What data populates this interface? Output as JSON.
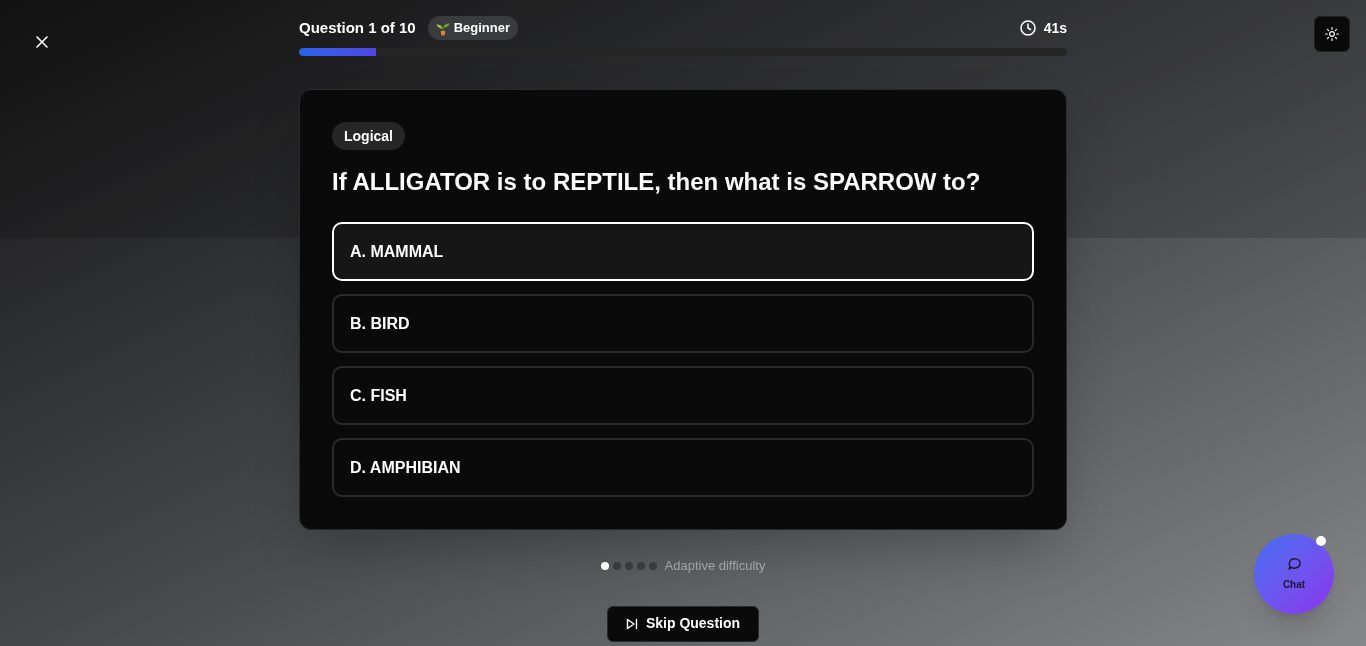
{
  "header": {
    "question_counter": "Question 1 of 10",
    "difficulty_badge": "Beginner",
    "timer": "41s",
    "progress": {
      "level": 0.1
    }
  },
  "card": {
    "category_tag": "Logical",
    "question": "If ALLIGATOR is to REPTILE, then what is SPARROW to?",
    "options": [
      {
        "label": "A. MAMMAL",
        "selected": true
      },
      {
        "label": "B. BIRD",
        "selected": false
      },
      {
        "label": "C. FISH",
        "selected": false
      },
      {
        "label": "D. AMPHIBIAN",
        "selected": false
      }
    ]
  },
  "difficulty_indicator": {
    "dots": [
      {
        "on": true
      },
      {
        "on": false
      },
      {
        "on": false
      },
      {
        "on": false
      },
      {
        "on": false
      }
    ],
    "label": "Adaptive difficulty"
  },
  "skip_button": {
    "label": "Skip Question"
  },
  "chat_button": {
    "label": "Chat"
  }
}
